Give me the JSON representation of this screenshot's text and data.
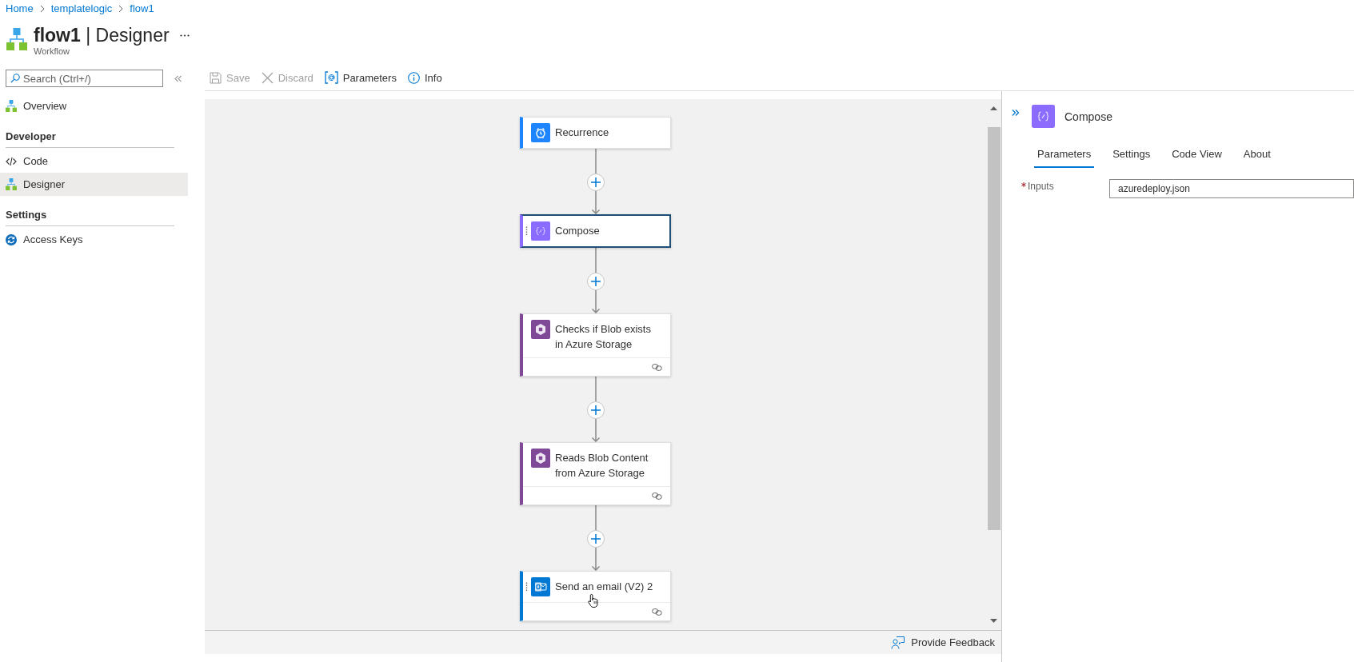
{
  "breadcrumb": [
    {
      "label": "Home"
    },
    {
      "label": "templatelogic"
    },
    {
      "label": "flow1"
    }
  ],
  "header": {
    "title": "**flow1** | Designer",
    "subtitle": "Workflow"
  },
  "sidebar": {
    "search": {
      "placeholder": "Search (Ctrl+/)"
    },
    "sections": [
      {
        "items": [
          {
            "label": "Overview",
            "kind": "workflow",
            "selected": false
          }
        ]
      },
      {
        "heading": "Developer",
        "items": [
          {
            "label": "Code",
            "kind": "code",
            "selected": false
          },
          {
            "label": "Designer",
            "kind": "workflow",
            "selected": true
          }
        ]
      },
      {
        "heading": "Settings",
        "items": [
          {
            "label": "Access Keys",
            "kind": "keys",
            "selected": false
          }
        ]
      }
    ]
  },
  "toolbar": [
    {
      "label": "Save",
      "kind": "save",
      "disabled": true
    },
    {
      "label": "Discard",
      "kind": "discard",
      "disabled": true
    },
    {
      "label": "Parameters",
      "kind": "parameters",
      "disabled": false
    },
    {
      "label": "Info",
      "kind": "info",
      "disabled": false
    }
  ],
  "canvas": {
    "steps": [
      {
        "title": "Recurrence",
        "kind": "schedule",
        "color": "#1f85ff",
        "selected": false,
        "hovered": false,
        "connection_footer": false
      },
      {
        "title": "Compose",
        "kind": "compose",
        "color": "#8c6cff",
        "selected": true,
        "hovered": false,
        "connection_footer": false
      },
      {
        "title": "Checks if Blob exists in Azure Storage",
        "kind": "storage",
        "color": "#804998",
        "selected": false,
        "hovered": false,
        "connection_footer": true
      },
      {
        "title": "Reads Blob Content from Azure Storage",
        "kind": "storage",
        "color": "#804998",
        "selected": false,
        "hovered": false,
        "connection_footer": true
      },
      {
        "title": "Send an email (V2) 2",
        "kind": "email",
        "color": "#0078d4",
        "selected": false,
        "hovered": true,
        "connection_footer": true
      }
    ],
    "feedback": "Provide Feedback"
  },
  "details_panel": {
    "title": "Compose",
    "tabs": [
      {
        "label": "Parameters",
        "selected": true
      },
      {
        "label": "Settings",
        "selected": false
      },
      {
        "label": "Code View",
        "selected": false
      },
      {
        "label": "About",
        "selected": false
      }
    ],
    "fields": [
      {
        "label": "Inputs",
        "required": true,
        "value": "azuredeploy.json"
      }
    ]
  }
}
